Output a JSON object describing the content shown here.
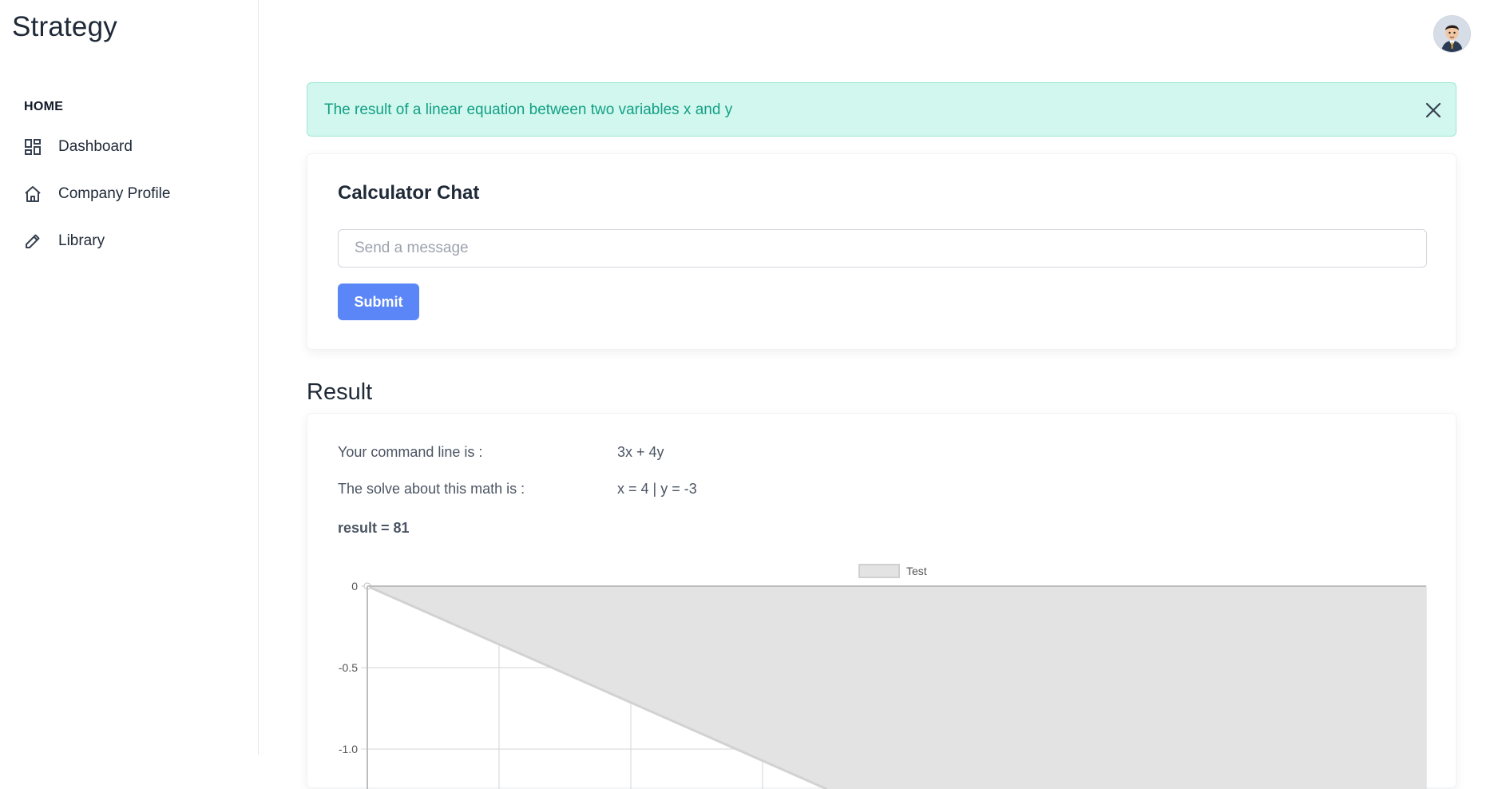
{
  "sidebar": {
    "brand": "Strategy",
    "section_label": "HOME",
    "items": [
      {
        "label": "Dashboard",
        "icon": "dashboard-icon"
      },
      {
        "label": "Company Profile",
        "icon": "home-icon"
      },
      {
        "label": "Library",
        "icon": "pencil-icon"
      }
    ]
  },
  "header": {
    "avatar": "user-avatar"
  },
  "alert": {
    "message": "The result of a linear equation between two variables x and y",
    "close_icon": "close-icon",
    "colors": {
      "background": "#d1f7ee",
      "text": "#14a085"
    }
  },
  "chat": {
    "title": "Calculator Chat",
    "input_placeholder": "Send a message",
    "input_value": "",
    "submit_label": "Submit",
    "accent": "#5b86f7"
  },
  "result": {
    "heading": "Result",
    "rows": [
      {
        "label": "Your command line is :",
        "value": "3x + 4y"
      },
      {
        "label": "The solve about this math is :",
        "value": "x = 4 | y = -3"
      }
    ],
    "result_line": "result = 81"
  },
  "chart_data": {
    "type": "area",
    "legend": [
      "Test"
    ],
    "legend_position": "top-center",
    "grid": true,
    "y_tick_labels": [
      "0",
      "-0.5",
      "-1.0"
    ],
    "ylim": [
      -1.0,
      0
    ],
    "series": [
      {
        "name": "Test",
        "fill": "#e3e3e3",
        "stroke": "#d2d2d2",
        "points": [
          [
            0,
            0
          ],
          [
            2.8,
            -1.0
          ]
        ]
      }
    ],
    "x_gridlines": 8
  }
}
